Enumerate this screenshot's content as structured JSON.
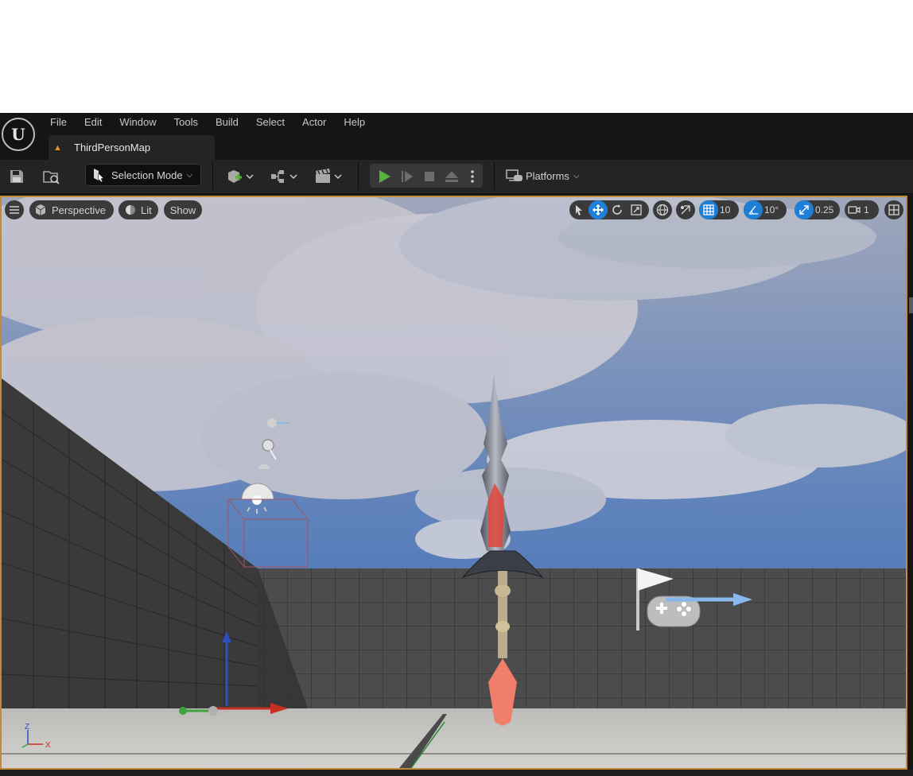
{
  "menu": {
    "items": [
      "File",
      "Edit",
      "Window",
      "Tools",
      "Build",
      "Select",
      "Actor",
      "Help"
    ]
  },
  "tab": {
    "label": "ThirdPersonMap",
    "icon": "level-map-icon"
  },
  "toolbar": {
    "selection_mode_label": "Selection Mode",
    "platforms_label": "Platforms",
    "icons": [
      "save-icon",
      "content-browser-icon",
      "add-actor-icon",
      "blueprint-icon",
      "cinematics-icon",
      "play-icon",
      "advance-frame-icon",
      "stop-icon",
      "eject-icon",
      "more-options-icon",
      "platforms-icon"
    ],
    "colors": {
      "play": "#57b33c",
      "accent": "#1f7fd6",
      "viewport_border": "#c28a35"
    }
  },
  "viewport": {
    "view_mode_label": "Perspective",
    "lighting_label": "Lit",
    "show_label": "Show",
    "grid_snap_value": "10",
    "rotation_snap_value": "10°",
    "scale_snap_value": "0.25",
    "camera_speed_value": "1",
    "axis_labels": {
      "z": "Z",
      "x": "X"
    }
  }
}
